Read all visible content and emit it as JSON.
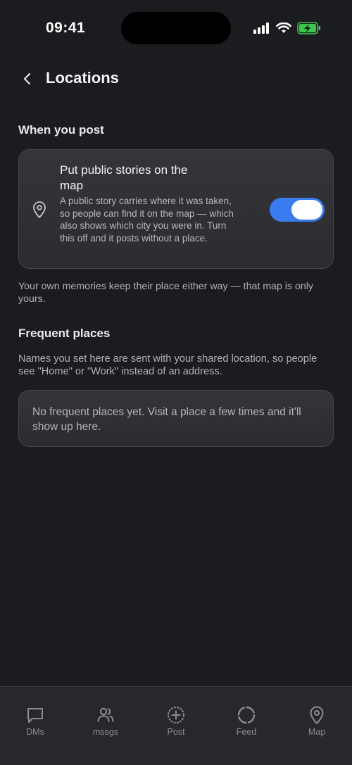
{
  "status_bar": {
    "time": "09:41",
    "icons": [
      "signal-icon",
      "wifi-icon",
      "battery-charging-icon"
    ],
    "battery_color": "#3ec74a"
  },
  "header": {
    "back_icon": "chevron-left-icon",
    "title": "Locations"
  },
  "when_you_post": {
    "heading": "When you post",
    "toggle": {
      "icon": "map-pin-icon",
      "title": "Put public stories on the map",
      "description": "A public story carries where it was taken, so people can find it on the map — which also shows which city you were in. Turn this off and it posts without a place.",
      "enabled": true,
      "accent_color": "#3a7cf0"
    },
    "note": "Your own memories keep their place either way — that map is only yours."
  },
  "frequent_places": {
    "heading": "Frequent places",
    "description": "Names you set here are sent with your shared location, so people see \"Home\" or \"Work\" instead of an address.",
    "empty_state": "No frequent places yet. Visit a place a few times and it'll show up here."
  },
  "tab_bar": {
    "tabs": [
      {
        "label": "DMs",
        "icon": "chat-bubble-icon"
      },
      {
        "label": "mssgs",
        "icon": "people-icon"
      },
      {
        "label": "Post",
        "icon": "plus-circle-icon"
      },
      {
        "label": "Feed",
        "icon": "circle-icon"
      },
      {
        "label": "Map",
        "icon": "map-pin-icon"
      }
    ]
  }
}
